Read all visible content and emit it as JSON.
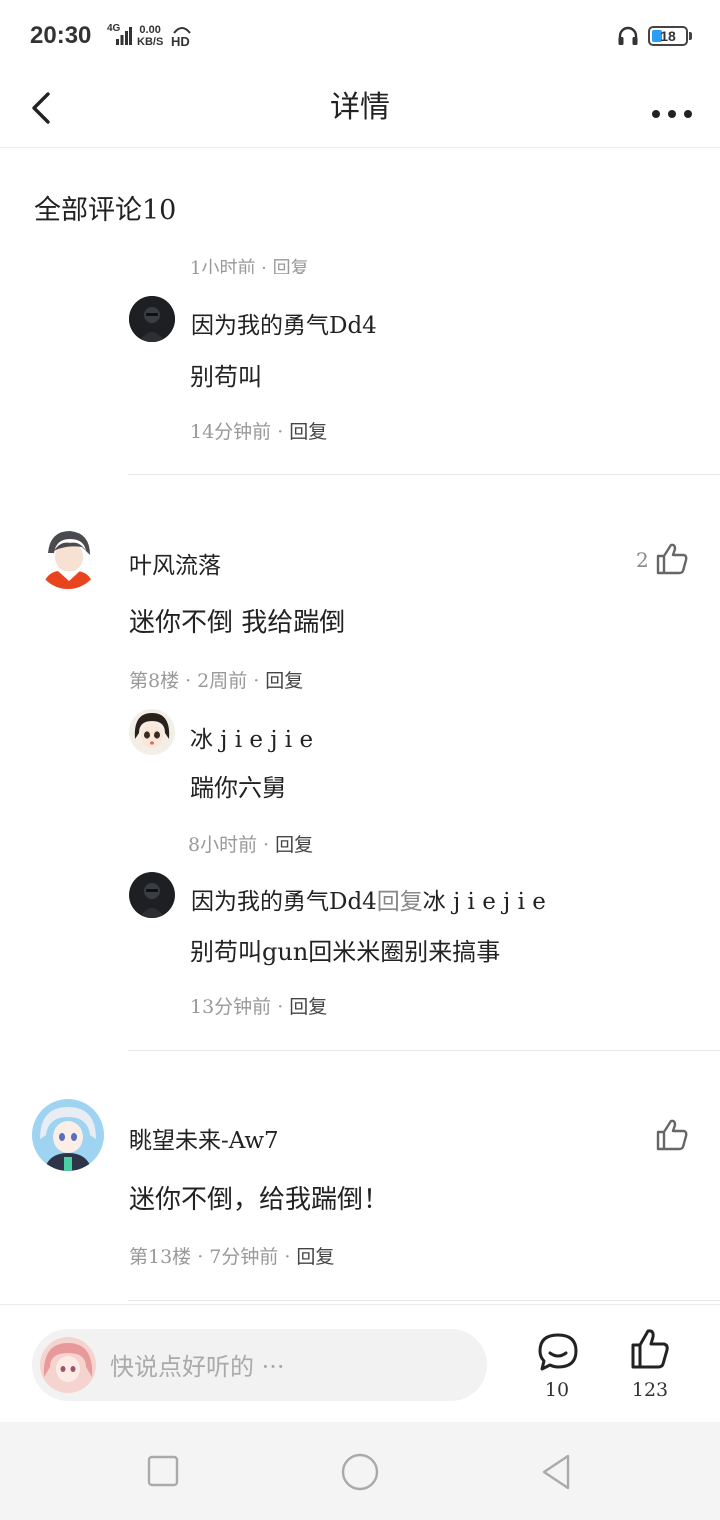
{
  "status_bar": {
    "time": "20:30",
    "network": "4G",
    "speed_value": "0.00",
    "speed_unit": "KB/S",
    "hd": "HD",
    "battery": "18"
  },
  "header": {
    "title": "详情"
  },
  "section": {
    "title": "全部评论10"
  },
  "partial_reply": {
    "meta": "1小时前 · 回复"
  },
  "thread1": {
    "reply": {
      "name": "因为我的勇气Dd4",
      "content": "别苟叫",
      "time": "14分钟前",
      "reply_label": "回复"
    }
  },
  "comment1": {
    "name": "叶风流落",
    "content": "迷你不倒    我给踹倒",
    "floor": "第8楼",
    "time": "2周前",
    "reply_label": "回复",
    "likes": "2",
    "replies": [
      {
        "name": "冰 j i e  j i e",
        "content": "踹你六舅",
        "time": "8小时前",
        "reply_label": "回复"
      },
      {
        "name": "因为我的勇气Dd4",
        "reply_word": "回复",
        "reply_target": "冰 j i e  j i e",
        "content": "别苟叫gun回米米圈别来搞事",
        "time": "13分钟前",
        "reply_label": "回复"
      }
    ]
  },
  "comment2": {
    "name": "眺望未来-Aw7",
    "content": "迷你不倒，给我踹倒！",
    "floor": "第13楼",
    "time": "7分钟前",
    "reply_label": "回复"
  },
  "bottom_bar": {
    "placeholder": "快说点好听的 ···",
    "comment_count": "10",
    "like_count": "123"
  }
}
